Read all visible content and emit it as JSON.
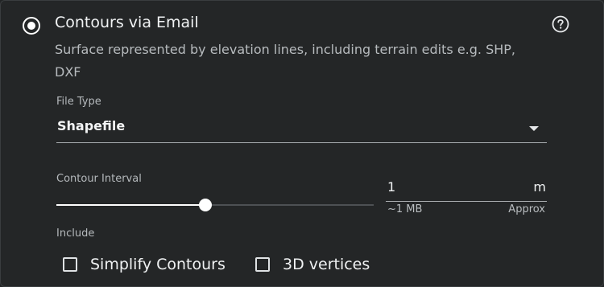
{
  "option": {
    "title": "Contours via Email",
    "selected": true,
    "description": "Surface represented by elevation lines, including terrain edits e.g. SHP, DXF",
    "help_icon": "help-circle-icon"
  },
  "file_type": {
    "label": "File Type",
    "value": "Shapefile",
    "caret_icon": "caret-down-icon"
  },
  "contour_interval": {
    "label": "Contour Interval",
    "slider_level": 0.47,
    "value": "1",
    "unit": "m",
    "size_estimate": "~1 MB",
    "approx_label": "Approx"
  },
  "include": {
    "label": "Include",
    "options": [
      {
        "label": "Simplify Contours",
        "checked": false
      },
      {
        "label": "3D vertices",
        "checked": false
      }
    ]
  },
  "colors": {
    "background": "#242627",
    "text": "#e9ebec",
    "muted": "#b7bbbe",
    "accent": "#ffffff"
  }
}
